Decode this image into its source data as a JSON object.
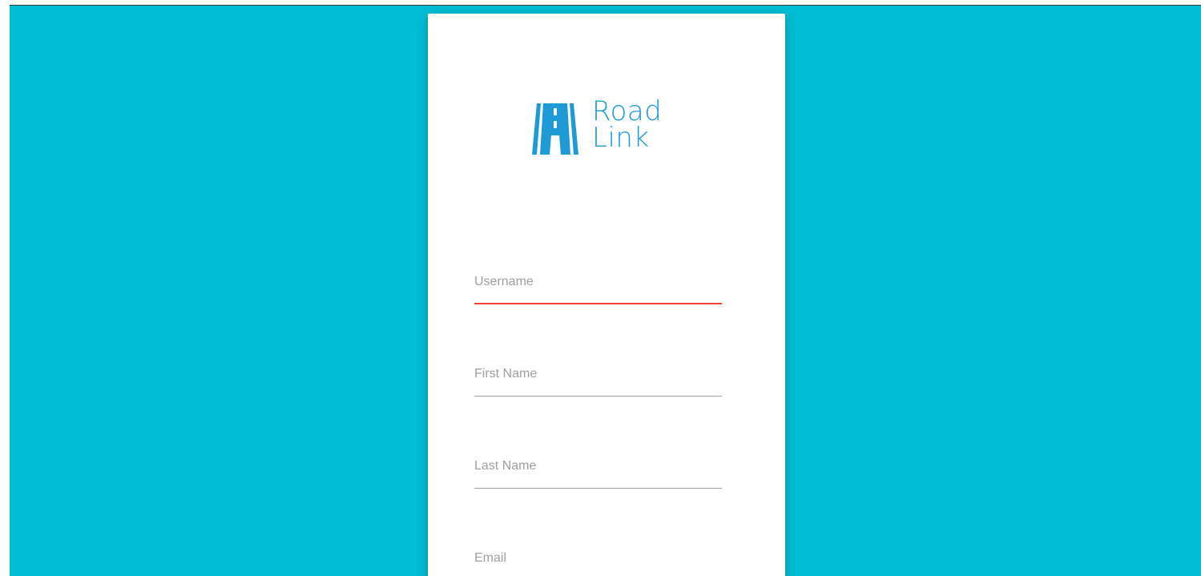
{
  "brand": {
    "name_line1": "Road",
    "name_line2": "Link",
    "color": "#1e9ad6",
    "icon": "road-logo-icon"
  },
  "theme": {
    "background": "#00bcd4",
    "card": "#ffffff",
    "error_underline": "#f44336",
    "underline": "#9e9e9e",
    "label_color": "#9e9e9e"
  },
  "form": {
    "fields": [
      {
        "id": "username",
        "label": "Username",
        "value": "",
        "state": "error"
      },
      {
        "id": "first_name",
        "label": "First Name",
        "value": "",
        "state": "normal"
      },
      {
        "id": "last_name",
        "label": "Last Name",
        "value": "",
        "state": "normal"
      },
      {
        "id": "email",
        "label": "Email",
        "value": "",
        "state": "normal"
      }
    ]
  }
}
